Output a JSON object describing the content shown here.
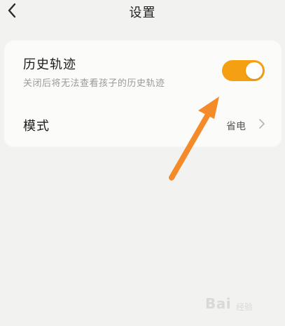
{
  "header": {
    "title": "设置",
    "back_icon": "chevron-left-icon"
  },
  "history_track": {
    "title": "历史轨迹",
    "description": "关闭后将无法查看孩子的历史轨迹",
    "toggle_on": true,
    "toggle_color": "#f5a012"
  },
  "mode": {
    "label": "模式",
    "value": "省电",
    "chevron_icon": "chevron-right-icon"
  },
  "annotation": {
    "arrow_color": "#f58a2a"
  },
  "watermark": {
    "text": "Bai",
    "sub": "经验"
  }
}
